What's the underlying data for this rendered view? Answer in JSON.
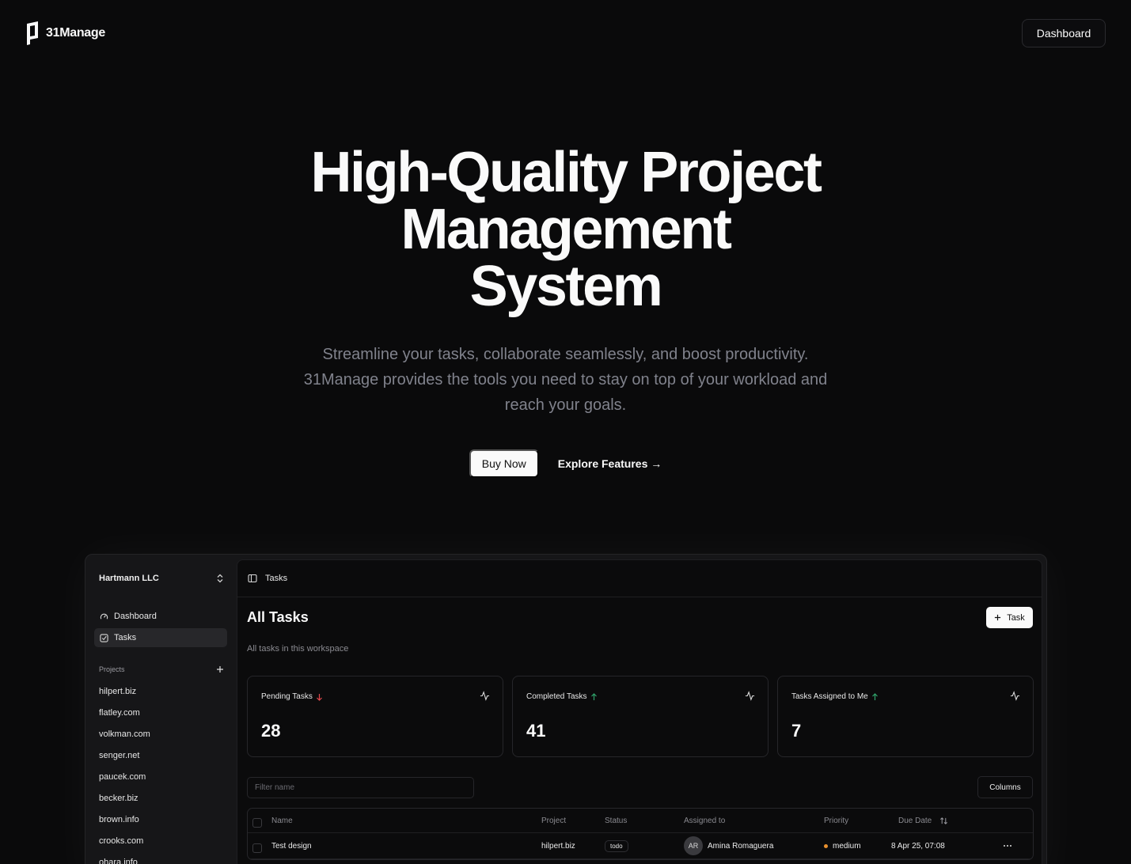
{
  "header": {
    "brand": "31Manage",
    "dashboard_label": "Dashboard"
  },
  "hero": {
    "title_lines": [
      "High-Quality Project",
      "Management",
      "System"
    ],
    "subtitle": "Streamline your tasks, collaborate seamlessly, and boost productivity. 31Manage provides the tools you need to stay on top of your workload and reach your goals.",
    "buy_label": "Buy Now",
    "explore_label": "Explore Features →"
  },
  "app": {
    "workspace": "Hartmann LLC",
    "nav": [
      {
        "label": "Dashboard",
        "icon": "gauge-icon"
      },
      {
        "label": "Tasks",
        "icon": "checkbox-icon",
        "active": true
      }
    ],
    "projects_heading": "Projects",
    "projects": [
      "hilpert.biz",
      "flatley.com",
      "volkman.com",
      "senger.net",
      "paucek.com",
      "becker.biz",
      "brown.info",
      "crooks.com",
      "ohara.info"
    ],
    "breadcrumb": "Tasks",
    "page_title": "All Tasks",
    "add_task_label": "Task",
    "page_subtitle": "All tasks in this workspace",
    "cards": [
      {
        "title": "Pending Tasks",
        "value": "28",
        "trend": "down",
        "trend_color": "#e5484d"
      },
      {
        "title": "Completed Tasks",
        "value": "41",
        "trend": "up",
        "trend_color": "#30a46c"
      },
      {
        "title": "Tasks Assigned to Me",
        "value": "7",
        "trend": "up",
        "trend_color": "#30a46c"
      }
    ],
    "filter_placeholder": "Filter name",
    "columns_label": "Columns",
    "table": {
      "headers": {
        "name": "Name",
        "project": "Project",
        "status": "Status",
        "assigned": "Assigned to",
        "priority": "Priority",
        "due": "Due Date"
      },
      "rows": [
        {
          "name": "Test design",
          "project": "hilpert.biz",
          "status": "todo",
          "initials": "AR",
          "assignee": "Amina Romaguera",
          "priority": "medium",
          "due": "8 Apr 25, 07:08"
        }
      ]
    }
  }
}
